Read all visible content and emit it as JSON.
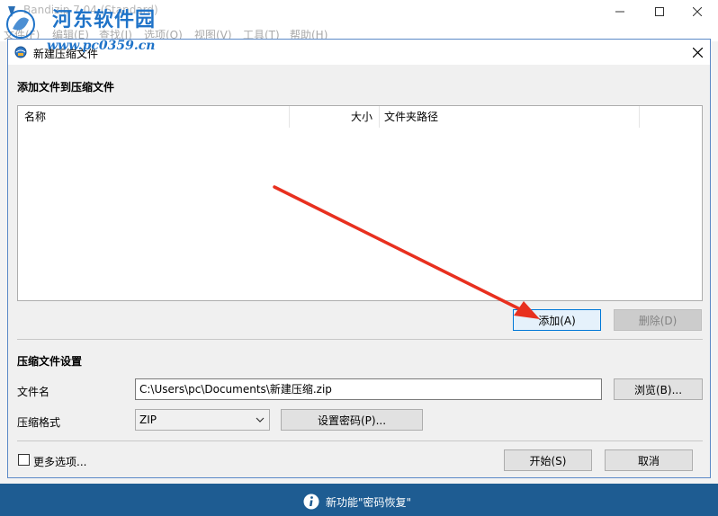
{
  "app": {
    "title": "Bandizip 7.04 (Standard)",
    "menu": [
      "文件(F)",
      "编辑(E)",
      "查找(I)",
      "选项(O)",
      "视图(V)",
      "工具(T)",
      "帮助(H)"
    ]
  },
  "watermark": {
    "title": "河东软件园",
    "url": "www.pc0359.cn"
  },
  "dialog": {
    "title": "新建压缩文件",
    "add_section_title": "添加文件到压缩文件",
    "columns": [
      "名称",
      "大小",
      "文件夹路径"
    ],
    "add_button": "添加(A)",
    "delete_button": "删除(D)",
    "settings_title": "压缩文件设置",
    "filename_label": "文件名",
    "filename_value": "C:\\Users\\pc\\Documents\\新建压缩.zip",
    "browse_button": "浏览(B)...",
    "format_label": "压缩格式",
    "format_value": "ZIP",
    "password_button": "设置密码(P)...",
    "more_options_label": "更多选项...",
    "start_button": "开始(S)",
    "cancel_button": "取消"
  },
  "statusbar": {
    "text": "新功能\"密码恢复\""
  },
  "colors": {
    "statusbar": "#1e5c92",
    "arrow": "#e8301f",
    "watermark": "#1f73c8",
    "primary_border": "#0078d7"
  }
}
